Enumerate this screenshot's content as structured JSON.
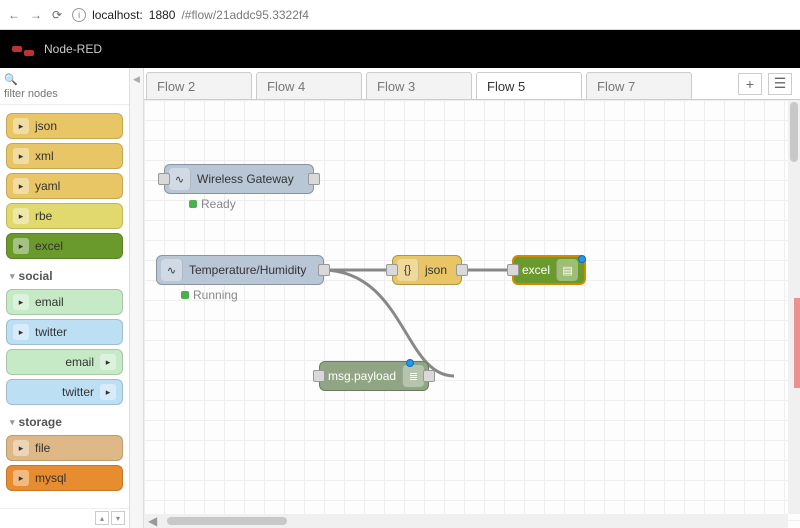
{
  "browser": {
    "url_host": "localhost:",
    "url_port": "1880",
    "url_path": "/#flow/21addc95.3322f4"
  },
  "app": {
    "title": "Node-RED"
  },
  "filter": {
    "placeholder": "filter nodes"
  },
  "palette": {
    "nodes_a": [
      {
        "label": "json",
        "color": "#e8c666"
      },
      {
        "label": "xml",
        "color": "#e8c666"
      },
      {
        "label": "yaml",
        "color": "#e8c666"
      },
      {
        "label": "rbe",
        "color": "#e2d96e"
      },
      {
        "label": "excel",
        "color": "#6b9a2c"
      }
    ],
    "cat_social": "social",
    "nodes_social": [
      {
        "label": "email",
        "color": "#c6e9c6",
        "out": false
      },
      {
        "label": "twitter",
        "color": "#bcdff3",
        "out": false
      },
      {
        "label": "email",
        "color": "#c6e9c6",
        "out": true
      },
      {
        "label": "twitter",
        "color": "#bcdff3",
        "out": true
      }
    ],
    "cat_storage": "storage",
    "nodes_storage": [
      {
        "label": "file",
        "color": "#deb887"
      },
      {
        "label": "mysql",
        "color": "#e88c30"
      }
    ]
  },
  "tabs": [
    {
      "label": "Flow 2"
    },
    {
      "label": "Flow 4"
    },
    {
      "label": "Flow 3"
    },
    {
      "label": "Flow 5",
      "active": true
    },
    {
      "label": "Flow 7"
    }
  ],
  "canvas": {
    "gateway": {
      "label": "Wireless Gateway",
      "status": "Ready",
      "status_color": "#4caf50"
    },
    "temp": {
      "label": "Temperature/Humidity",
      "status": "Running",
      "status_color": "#4caf50"
    },
    "json": {
      "label": "json"
    },
    "excel": {
      "label": "excel"
    },
    "debug": {
      "label": "msg.payload"
    }
  }
}
